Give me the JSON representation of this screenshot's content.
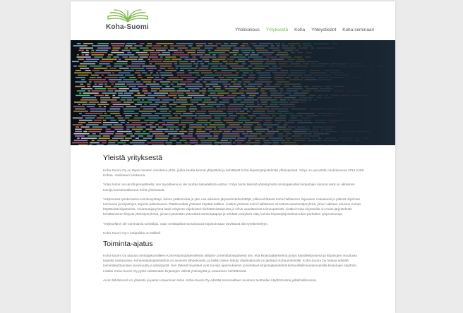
{
  "logo": {
    "text": "Koha-Suomi",
    "icon": "open-book-icon",
    "color": "#7ab648"
  },
  "nav": {
    "items": [
      {
        "label": "Yhtiökokous",
        "active": false
      },
      {
        "label": "Yrityksestä",
        "active": true
      },
      {
        "label": "Koha",
        "active": false
      },
      {
        "label": "Yhteystiedot",
        "active": false
      },
      {
        "label": "Koha-seminaari",
        "active": false
      }
    ]
  },
  "hero": {
    "alt_icon": "code-screen-image"
  },
  "main": {
    "heading1": "Yleistä yrityksestä",
    "paragraphs1": [
      "Koha-Suomi Oy on täysin kuntien omistama yhtiö, jonka kautta kunnat ylläpitävät ja kehittävät Koha-kirjastojärjestelmää yhteistyössä. Yritys on perustettu toukokuussa 2016 Kohti Kohaa –hankkeen tuloksena.",
      "Yritys toimii non-profit-periaatteella; sen tavoitteena ei ole tuottaa taloudellista voittoa. Yritys toimii tiiviissä yhteistyössä omistajakuntien kirjastojen kanssa sekä on aktiivinen toimija kansainvälisessä Koha-yhteisössä.",
      "Yrityksessä työskentelee toimitusjohtaja, kolme päätoimista ja yksi osa-aikainen järjestelmänkehittäjä, jotka kehittävät Koha-hallituksen linjausten mukaisesti ja pitävät ohjelman toimivana ja kirjastojen tarpeita palvelevana. Päätösvaltaa yhtiössä käyttää hallitus. Lisäksi yhtiössä toimii hallituksen nimeämä asiantuntijaryhmä, johon valitaan edustus Kohaa käyttävistä kirjastoista. Asiantuntijaryhmä laatii esitykset ohjelmiston kehittämistarpeista ja niihin vaadittavista toimenpiteistä. Lisäksi Koha-kirjastoilla on muita järjestelmän kehittämiseen liittyviä yhteistyöryhmiä, joissa työstetään yhtenäisiä toimintatapoja ja tehdään esityksiä siitä, kuinka kirjastojärjestelmä tukisi parhaiten työprosesseja.",
      "Yrityksellä ei ole varsinaisia toimitiloja, vaan omistajakunnat tarjoavat kirjastoissaan tarvittavat tilat työskentelyyn.",
      "Koha-Suomi Oy:n kotipaikka on Mikkeli."
    ],
    "heading2": "Toiminta-ajatus",
    "paragraphs2": [
      "Koha-Suomi Oy tarjoaa omistajakunnilleen Koha-kirjastojärjestelmän ylläpito- ja kehittämispalvelut niin, että kirjastojärjestelmä pysyy käyttökelpoisena ja kirjastojen muuttuvia tarpeita vastaavana. Koha-kirjastojärjestelmä on avoimen lähdekoodin, ja kaikki siihen tehdyt ohjelmakoodit on jaettava Koha-yhteisölle. Koha-Suomi Oy haluaa edistää toimintakulttuuriaan avoimuutta ja yhteistyötä. Sen tärkeät tavoitteet ovat turvata ajanmukainen ja kehittyvä kirjastojärjestelmä kohtuullisilla kustannuksilla kirjastojen käyttöön. Lisäksi Koha-Suomi Oy pyrkii edistämään kirjastojen välistä yhteistyötä ja osaamisen kehittämistä.",
      "Avoin lähdekoodi on yhteisön ja jaetun osaamisen tulos. Koha-Suomi Oy edistää toiminnallaan avoimen tuotteiden käyttöönottoa julkishallinnossa."
    ]
  }
}
